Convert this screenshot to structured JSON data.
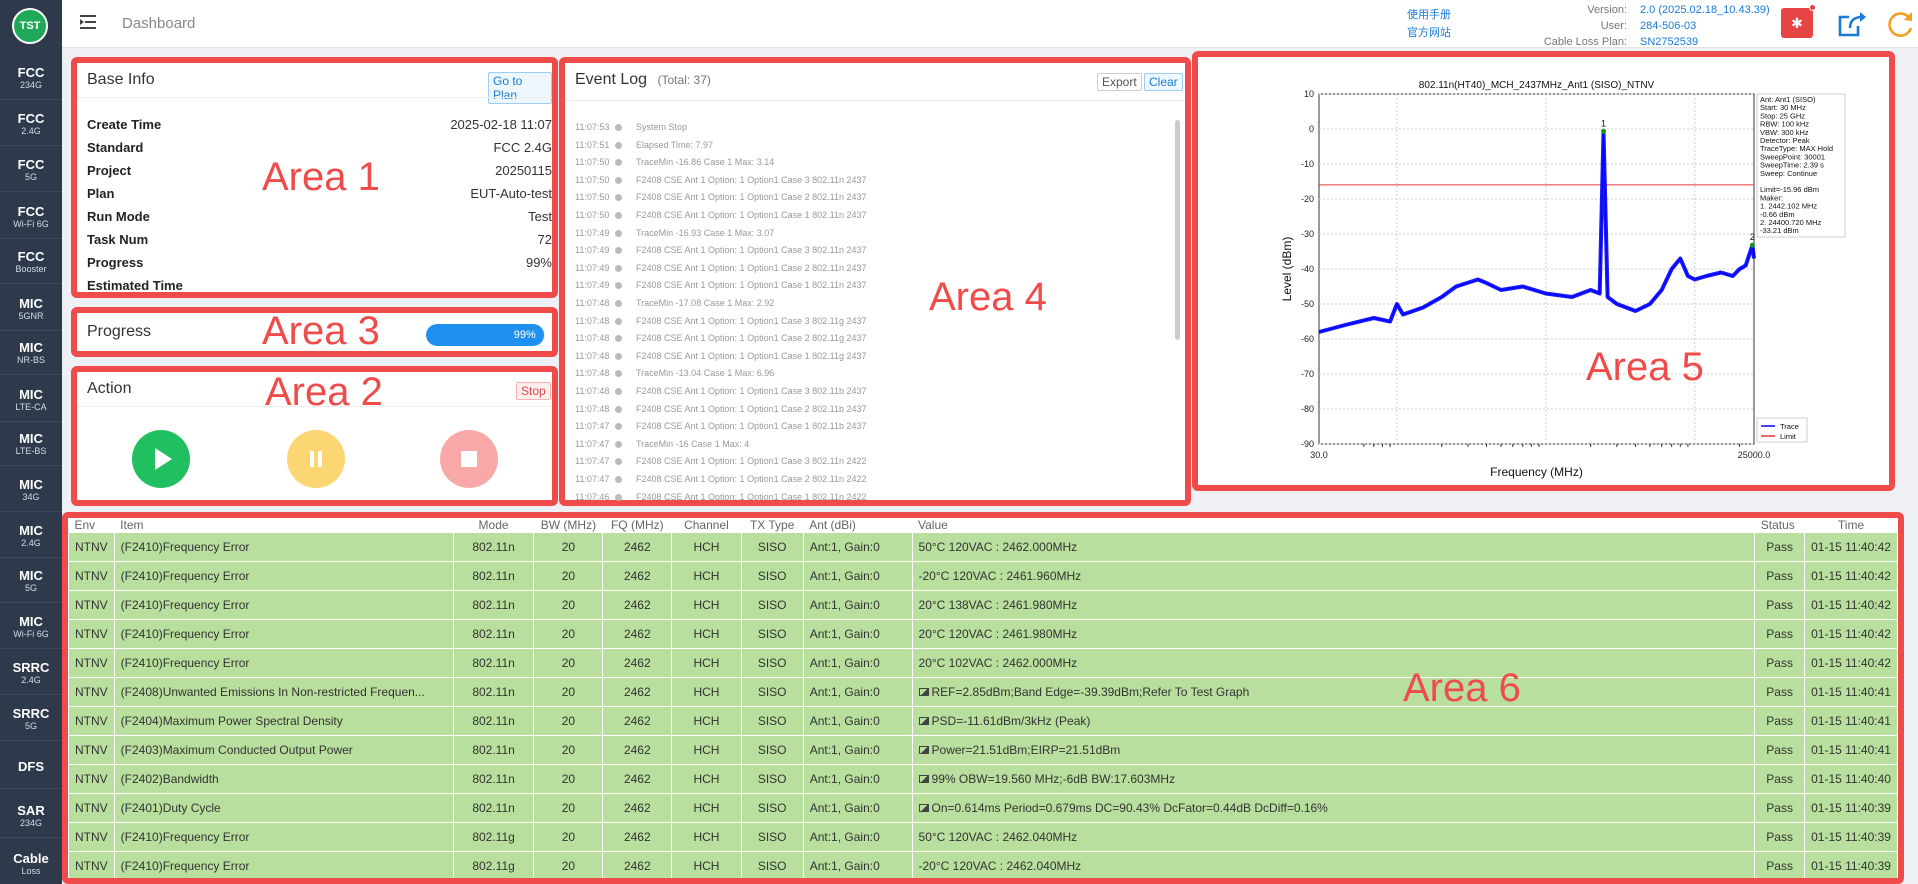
{
  "logo": "TST",
  "sidebar": [
    {
      "a": "FCC",
      "b": "234G"
    },
    {
      "a": "FCC",
      "b": "2.4G"
    },
    {
      "a": "FCC",
      "b": "5G"
    },
    {
      "a": "FCC",
      "b": "Wi-Fi 6G"
    },
    {
      "a": "FCC",
      "b": "Booster"
    },
    {
      "a": "MIC",
      "b": "5GNR"
    },
    {
      "a": "MIC",
      "b": "NR-BS"
    },
    {
      "a": "MIC",
      "b": "LTE-CA"
    },
    {
      "a": "MIC",
      "b": "LTE-BS"
    },
    {
      "a": "MIC",
      "b": "34G"
    },
    {
      "a": "MIC",
      "b": "2.4G"
    },
    {
      "a": "MIC",
      "b": "5G"
    },
    {
      "a": "MIC",
      "b": "Wi-Fi 6G"
    },
    {
      "a": "SRRC",
      "b": "2.4G"
    },
    {
      "a": "SRRC",
      "b": "5G"
    },
    {
      "a": "DFS",
      "b": ""
    },
    {
      "a": "SAR",
      "b": "234G"
    },
    {
      "a": "Cable",
      "b": "Loss"
    }
  ],
  "header": {
    "breadcrumb": "Dashboard",
    "manual": "使用手册",
    "website": "官方网站",
    "version_label": "Version:",
    "version": "2.0 (2025.02.18_10.43.39)",
    "user_label": "User:",
    "user": "284-506-03",
    "cable_label": "Cable Loss Plan:",
    "cable": "SN2752539"
  },
  "areas": {
    "a1": "Area 1",
    "a2": "Area 2",
    "a3": "Area 3",
    "a4": "Area 4",
    "a5": "Area 5",
    "a6": "Area 6"
  },
  "base_info": {
    "title": "Base Info",
    "goto": "Go to Plan",
    "rows": [
      {
        "k": "Create Time",
        "v": "2025-02-18 11:07"
      },
      {
        "k": "Standard",
        "v": "FCC 2.4G"
      },
      {
        "k": "Project",
        "v": "20250115"
      },
      {
        "k": "Plan",
        "v": "EUT-Auto-test"
      },
      {
        "k": "Run Mode",
        "v": "Test"
      },
      {
        "k": "Task Num",
        "v": "72"
      },
      {
        "k": "Progress",
        "v": "99%"
      },
      {
        "k": "Estimated Time",
        "v": ""
      }
    ]
  },
  "progress": {
    "title": "Progress",
    "value": "99%",
    "fraction": 0.99
  },
  "action": {
    "title": "Action",
    "stop": "Stop"
  },
  "event_log": {
    "title": "Event Log",
    "total": "(Total: 37)",
    "export": "Export",
    "clear": "Clear",
    "entries": [
      {
        "t": "11:07:53",
        "m": "System Stop"
      },
      {
        "t": "11:07:51",
        "m": "Elapsed Time: 7.97"
      },
      {
        "t": "11:07:50",
        "m": "TraceMin -16.86 Case 1 Max: 3.14"
      },
      {
        "t": "11:07:50",
        "m": "F2408 CSE Ant 1 Option: 1 Option1 Case 3 802.11n 2437"
      },
      {
        "t": "11:07:50",
        "m": "F2408 CSE Ant 1 Option: 1 Option1 Case 2 802.11n 2437"
      },
      {
        "t": "11:07:50",
        "m": "F2408 CSE Ant 1 Option: 1 Option1 Case 1 802.11n 2437"
      },
      {
        "t": "11:07:49",
        "m": "TraceMin -16.93 Case 1 Max: 3.07"
      },
      {
        "t": "11:07:49",
        "m": "F2408 CSE Ant 1 Option: 1 Option1 Case 3 802.11n 2437"
      },
      {
        "t": "11:07:49",
        "m": "F2408 CSE Ant 1 Option: 1 Option1 Case 2 802.11n 2437"
      },
      {
        "t": "11:07:49",
        "m": "F2408 CSE Ant 1 Option: 1 Option1 Case 1 802.11n 2437"
      },
      {
        "t": "11:07:48",
        "m": "TraceMin -17.08 Case 1 Max: 2.92"
      },
      {
        "t": "11:07:48",
        "m": "F2408 CSE Ant 1 Option: 1 Option1 Case 3 802.11g 2437"
      },
      {
        "t": "11:07:48",
        "m": "F2408 CSE Ant 1 Option: 1 Option1 Case 2 802.11g 2437"
      },
      {
        "t": "11:07:48",
        "m": "F2408 CSE Ant 1 Option: 1 Option1 Case 1 802.11g 2437"
      },
      {
        "t": "11:07:48",
        "m": "TraceMin -13.04 Case 1 Max: 6.96"
      },
      {
        "t": "11:07:48",
        "m": "F2408 CSE Ant 1 Option: 1 Option1 Case 3 802.11b 2437"
      },
      {
        "t": "11:07:48",
        "m": "F2408 CSE Ant 1 Option: 1 Option1 Case 2 802.11b 2437"
      },
      {
        "t": "11:07:47",
        "m": "F2408 CSE Ant 1 Option: 1 Option1 Case 1 802.11b 2437"
      },
      {
        "t": "11:07:47",
        "m": "TraceMin -16 Case 1 Max: 4"
      },
      {
        "t": "11:07:47",
        "m": "F2408 CSE Ant 1 Option: 1 Option1 Case 3 802.11n 2422"
      },
      {
        "t": "11:07:47",
        "m": "F2408 CSE Ant 1 Option: 1 Option1 Case 2 802.11n 2422"
      },
      {
        "t": "11:07:46",
        "m": "F2408 CSE Ant 1 Option: 1 Option1 Case 1 802.11n 2422"
      }
    ]
  },
  "chart_data": {
    "type": "line",
    "title": "802.11n(HT40)_MCH_2437MHz_Ant1 (SISO)_NTNV",
    "xlabel": "Frequency (MHz)",
    "ylabel": "Level (dBm)",
    "xscale": "log",
    "xlim": [
      30,
      25000
    ],
    "ylim": [
      -90,
      10
    ],
    "xticks": [
      "30.0",
      "25000.0"
    ],
    "yticks": [
      10,
      0,
      -10,
      -20,
      -30,
      -40,
      -50,
      -60,
      -70,
      -80,
      -90
    ],
    "grid": true,
    "legend": "bottom-right",
    "series": [
      {
        "name": "Trace",
        "color": "#0000ff",
        "x": [
          30,
          45,
          70,
          90,
          100,
          110,
          150,
          200,
          250,
          350,
          400,
          500,
          700,
          1000,
          1500,
          2000,
          2300,
          2440,
          2600,
          3000,
          4000,
          5000,
          6000,
          7000,
          8000,
          9000,
          10000,
          12000,
          15000,
          18000,
          20000,
          22000,
          24400,
          25000
        ],
        "y": [
          -58,
          -56,
          -54,
          -55,
          -50,
          -53,
          -51,
          -48,
          -45,
          -43,
          -44,
          -46,
          -45,
          -47,
          -48,
          -46,
          -47,
          -0.66,
          -48,
          -50,
          -52,
          -50,
          -46,
          -40,
          -37,
          -42,
          -43,
          -42,
          -41,
          -42,
          -40,
          -39,
          -33.21,
          -37
        ]
      },
      {
        "name": "Limit",
        "color": "#e53935",
        "x": [
          30,
          25000
        ],
        "y": [
          -15.96,
          -15.96
        ]
      }
    ],
    "markers": [
      {
        "label": "1",
        "x": 2442.102,
        "y": -0.66
      },
      {
        "label": "2",
        "x": 24400.72,
        "y": -33.21
      }
    ],
    "annotations": [
      "Ant: Ant1 (SISO)",
      "Start: 30 MHz",
      "Stop: 25 GHz",
      "RBW: 100 kHz",
      "VBW: 300 kHz",
      "Detector: Peak",
      "TraceType: MAX Hold",
      "SweepPoint: 30001",
      "SweepTime: 2.39 s",
      "Sweep: Continue",
      "",
      "Limit=-15.96 dBm",
      "Maker:",
      "1. 2442.102 MHz",
      "   -0.66 dBm",
      "2. 24400.720 MHz",
      "   -33.21 dBm"
    ]
  },
  "table": {
    "headers": [
      "Env",
      "Item",
      "Mode",
      "BW (MHz)",
      "FQ (MHz)",
      "Channel",
      "TX Type",
      "Ant (dBi)",
      "Value",
      "Status",
      "Time"
    ],
    "rows": [
      [
        "NTNV",
        "(F2410)Frequency Error",
        "802.11n",
        "20",
        "2462",
        "HCH",
        "SISO",
        "Ant:1, Gain:0",
        "50°C 120VAC : 2462.000MHz",
        "Pass",
        "01-15 11:40:42"
      ],
      [
        "NTNV",
        "(F2410)Frequency Error",
        "802.11n",
        "20",
        "2462",
        "HCH",
        "SISO",
        "Ant:1, Gain:0",
        "-20°C 120VAC : 2461.960MHz",
        "Pass",
        "01-15 11:40:42"
      ],
      [
        "NTNV",
        "(F2410)Frequency Error",
        "802.11n",
        "20",
        "2462",
        "HCH",
        "SISO",
        "Ant:1, Gain:0",
        "20°C 138VAC : 2461.980MHz",
        "Pass",
        "01-15 11:40:42"
      ],
      [
        "NTNV",
        "(F2410)Frequency Error",
        "802.11n",
        "20",
        "2462",
        "HCH",
        "SISO",
        "Ant:1, Gain:0",
        "20°C 120VAC : 2461.980MHz",
        "Pass",
        "01-15 11:40:42"
      ],
      [
        "NTNV",
        "(F2410)Frequency Error",
        "802.11n",
        "20",
        "2462",
        "HCH",
        "SISO",
        "Ant:1, Gain:0",
        "20°C 102VAC : 2462.000MHz",
        "Pass",
        "01-15 11:40:42"
      ],
      [
        "NTNV",
        "(F2408)Unwanted Emissions In Non-restricted Frequen...",
        "802.11n",
        "20",
        "2462",
        "HCH",
        "SISO",
        "Ant:1, Gain:0",
        "REF=2.85dBm;Band Edge=-39.39dBm;Refer To Test Graph",
        "Pass",
        "01-15 11:40:41"
      ],
      [
        "NTNV",
        "(F2404)Maximum Power Spectral Density",
        "802.11n",
        "20",
        "2462",
        "HCH",
        "SISO",
        "Ant:1, Gain:0",
        "PSD=-11.61dBm/3kHz (Peak)",
        "Pass",
        "01-15 11:40:41"
      ],
      [
        "NTNV",
        "(F2403)Maximum Conducted Output Power",
        "802.11n",
        "20",
        "2462",
        "HCH",
        "SISO",
        "Ant:1, Gain:0",
        "Power=21.51dBm;EIRP=21.51dBm",
        "Pass",
        "01-15 11:40:41"
      ],
      [
        "NTNV",
        "(F2402)Bandwidth",
        "802.11n",
        "20",
        "2462",
        "HCH",
        "SISO",
        "Ant:1, Gain:0",
        "99% OBW=19.560 MHz;-6dB BW:17.603MHz",
        "Pass",
        "01-15 11:40:40"
      ],
      [
        "NTNV",
        "(F2401)Duty Cycle",
        "802.11n",
        "20",
        "2462",
        "HCH",
        "SISO",
        "Ant:1, Gain:0",
        "On=0.614ms Period=0.679ms DC=90.43% DcFator=0.44dB DcDiff=0.16%",
        "Pass",
        "01-15 11:40:39"
      ],
      [
        "NTNV",
        "(F2410)Frequency Error",
        "802.11g",
        "20",
        "2462",
        "HCH",
        "SISO",
        "Ant:1, Gain:0",
        "50°C 120VAC : 2462.040MHz",
        "Pass",
        "01-15 11:40:39"
      ],
      [
        "NTNV",
        "(F2410)Frequency Error",
        "802.11g",
        "20",
        "2462",
        "HCH",
        "SISO",
        "Ant:1, Gain:0",
        "-20°C 120VAC : 2462.040MHz",
        "Pass",
        "01-15 11:40:39"
      ]
    ],
    "graph_rows": [
      5,
      6,
      7,
      8,
      9
    ]
  }
}
